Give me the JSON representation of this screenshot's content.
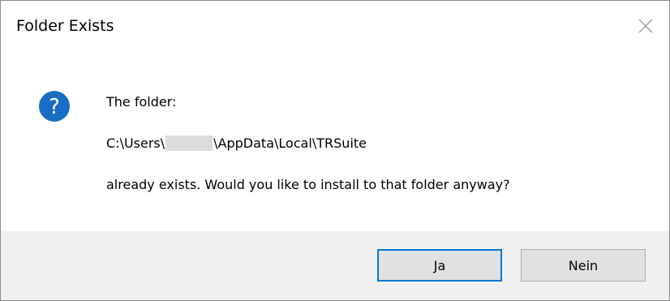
{
  "window": {
    "title": "Folder Exists",
    "close_icon": "close-icon"
  },
  "message": {
    "icon": "question-icon",
    "line1": "The folder:",
    "path_prefix": "C:\\Users\\",
    "path_suffix": "\\AppData\\Local\\TRSuite",
    "line3": "already exists. Would you like to install to that folder anyway?"
  },
  "buttons": {
    "yes_label": "Ja",
    "no_label": "Nein"
  },
  "colors": {
    "icon_blue": "#1a6dc5",
    "default_button_border": "#0078d7",
    "footer_bg": "#f0f0f0"
  }
}
